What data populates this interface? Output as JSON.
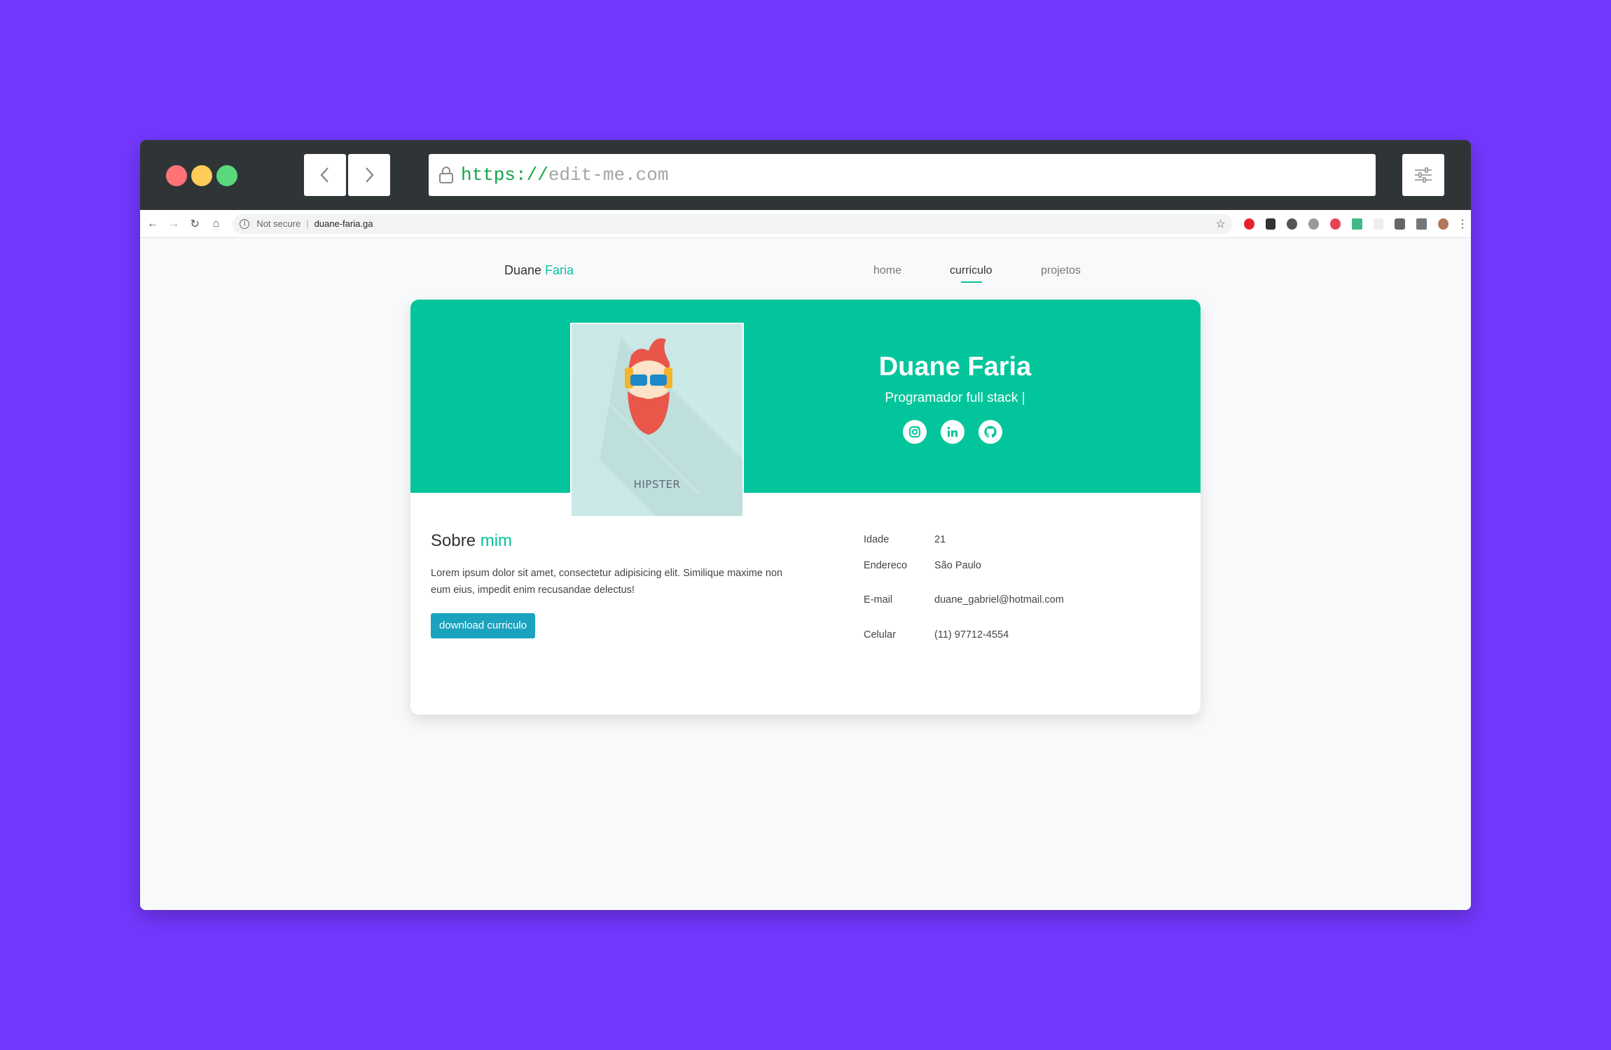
{
  "mock_browser": {
    "url_scheme": "https://",
    "url_host": "edit-me.com"
  },
  "browser_toolbar": {
    "security_label": "Not secure",
    "separator": "|",
    "site_url": "duane-faria.ga"
  },
  "site": {
    "brand_first": "Duane",
    "brand_last": "Faria",
    "nav": {
      "home": "home",
      "curriculo": "curriculo",
      "projetos": "projetos"
    }
  },
  "profile": {
    "name": "Duane Faria",
    "role": "Programador full stack |",
    "avatar_caption": "HIPSTER",
    "social": [
      "instagram-icon",
      "linkedin-icon",
      "github-icon"
    ],
    "about_title_first": "Sobre",
    "about_title_accent": "mim",
    "about_text": "Lorem ipsum dolor sit amet, consectetur adipisicing elit. Similique maxime non eum eius, impedit enim recusandae delectus!",
    "download_label": "download curriculo",
    "info": [
      {
        "label": "Idade",
        "value": "21"
      },
      {
        "label": "Endereco",
        "value": "São Paulo"
      },
      {
        "label": "E-mail",
        "value": "duane_gabriel@hotmail.com"
      },
      {
        "label": "Celular",
        "value": "(11) 97712-4554"
      }
    ]
  },
  "colors": {
    "background": "#7338ff",
    "accent": "#03c59c",
    "button": "#1aa2be"
  }
}
